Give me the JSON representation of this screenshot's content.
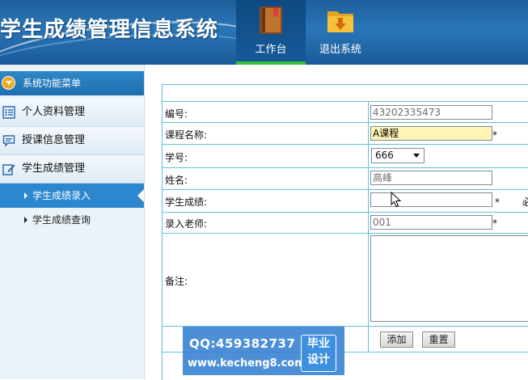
{
  "header": {
    "title": "学生成绩管理信息系统",
    "nav": [
      {
        "label": "工作台",
        "icon": "book-icon",
        "active": true
      },
      {
        "label": "退出系统",
        "icon": "download-folder-icon",
        "active": false
      }
    ]
  },
  "sidebar": {
    "header": "系统功能菜单",
    "menus": [
      {
        "label": "个人资料管理",
        "icon": "list-icon"
      },
      {
        "label": "授课信息管理",
        "icon": "comment-icon"
      },
      {
        "label": "学生成绩管理",
        "icon": "edit-icon"
      }
    ],
    "submenus": [
      {
        "label": "学生成绩录入",
        "active": true
      },
      {
        "label": "学生成绩查询",
        "active": false
      }
    ]
  },
  "form": {
    "fields": {
      "id": {
        "label": "编号:",
        "value": "43202335473"
      },
      "course": {
        "label": "课程名称:",
        "value": "A课程",
        "required": "*"
      },
      "student_no": {
        "label": "学号:",
        "value": "666"
      },
      "name": {
        "label": "姓名:",
        "value": "高峰"
      },
      "score": {
        "label": "学生成绩:",
        "value": "",
        "required": "*",
        "hint": "必"
      },
      "teacher": {
        "label": "录入老师:",
        "value": "001",
        "required": "*"
      },
      "remark": {
        "label": "备注:"
      }
    },
    "buttons": {
      "add": "添加",
      "reset": "重置"
    }
  },
  "watermark": {
    "qq": "QQ:459382737",
    "url": "www.kecheng8.com",
    "badge_line1": "毕业",
    "badge_line2": "设计"
  },
  "colors": {
    "accent": "#2c87cf",
    "grid": "#5bc4d8",
    "highlight": "#fdf5b5",
    "active_tab": "#37c037"
  }
}
